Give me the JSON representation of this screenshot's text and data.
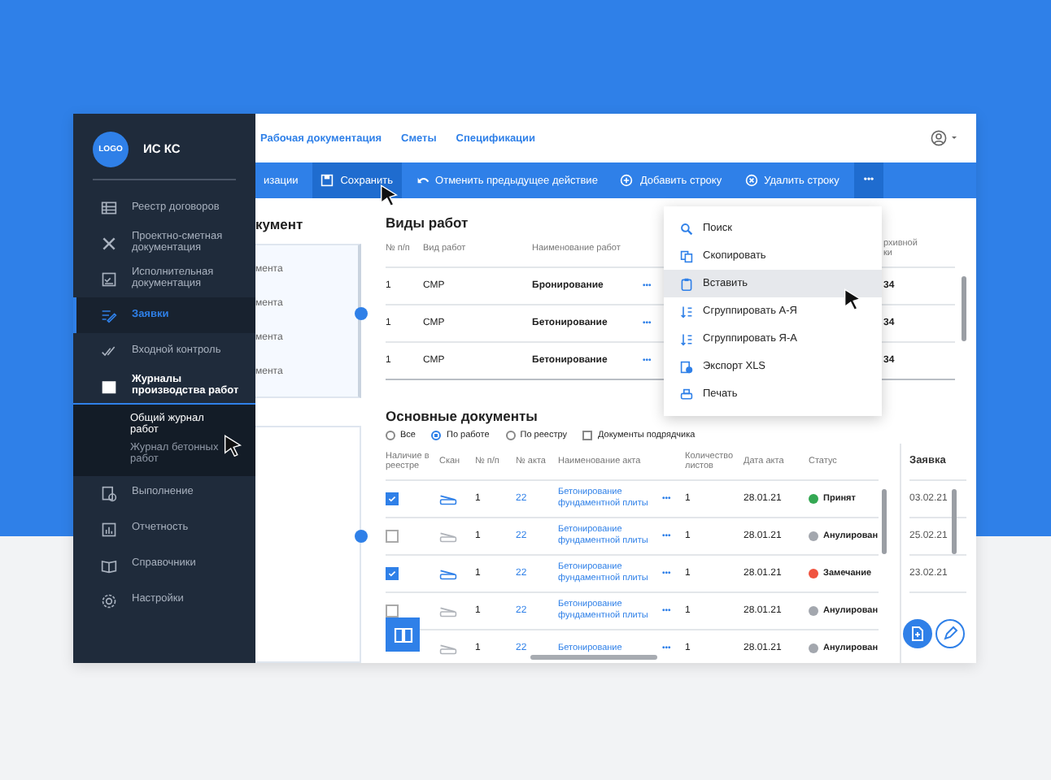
{
  "sidebar": {
    "logo": "LOGO",
    "title": "ИС КС",
    "items": [
      {
        "label": "Реестр договоров",
        "selected": false,
        "expanded": false
      },
      {
        "label": "Проектно-сметная документация",
        "selected": false,
        "expanded": false
      },
      {
        "label": "Исполнительная документация",
        "selected": false,
        "expanded": false
      },
      {
        "label": "Заявки",
        "selected": true,
        "expanded": false
      },
      {
        "label": "Входной контроль",
        "selected": false,
        "expanded": false
      },
      {
        "label": "Журналы производства работ",
        "selected": false,
        "expanded": true,
        "children": [
          {
            "label": "Общий журнал работ",
            "selected": true
          },
          {
            "label": "Журнал бетонных работ",
            "selected": false
          }
        ]
      },
      {
        "label": "Выполнение",
        "selected": false,
        "expanded": false
      },
      {
        "label": "Отчетность",
        "selected": false,
        "expanded": false
      },
      {
        "label": "Справочники",
        "selected": false,
        "expanded": false
      },
      {
        "label": "Настройки",
        "selected": false,
        "expanded": false
      }
    ]
  },
  "top_nav": {
    "tabs": [
      "Рабочая документация",
      "Сметы",
      "Спецификации"
    ]
  },
  "toolbar": {
    "items": [
      {
        "label": "изации",
        "active": false
      },
      {
        "label": "Сохранить",
        "active": true
      },
      {
        "label": "Отменить предыдущее действие",
        "active": false
      },
      {
        "label": "Добавить строку",
        "active": false
      },
      {
        "label": "Удалить строку",
        "active": false
      }
    ],
    "more": {
      "label": "•••",
      "active": true
    }
  },
  "left_panel": {
    "title": "кумент",
    "items": [
      "мента",
      "мента",
      "мента",
      "мента"
    ]
  },
  "work_types": {
    "title": "Виды работ",
    "columns": [
      "№ п/п",
      "Вид работ",
      "Наименование работ",
      "рхивной\nки"
    ],
    "rows": [
      {
        "number": "1",
        "type": "СМР",
        "name": "Бронирование",
        "more": "•••",
        "column_4": "34"
      },
      {
        "number": "1",
        "type": "СМР",
        "name": "Бетонирование",
        "more": "•••",
        "column_4": "34"
      },
      {
        "number": "1",
        "type": "СМР",
        "name": "Бетонирование",
        "more": "•••",
        "column_4": "34"
      }
    ]
  },
  "context_menu": {
    "items": [
      {
        "label": "Поиск",
        "selected": false
      },
      {
        "label": "Скопировать",
        "selected": false
      },
      {
        "label": "Вставить",
        "selected": true
      },
      {
        "label": "Сгруппировать А-Я",
        "selected": false
      },
      {
        "label": "Сгруппировать Я-А",
        "selected": false
      },
      {
        "label": "Экспорт XLS",
        "selected": false
      },
      {
        "label": "Печать",
        "selected": false
      }
    ]
  },
  "documents": {
    "title": "Основные документы",
    "filters": [
      {
        "label": "Все",
        "selected": false
      },
      {
        "label": "По работе",
        "selected": true
      },
      {
        "label": "По реестру",
        "selected": false
      }
    ],
    "contractor_docs": {
      "label": "Документы подрядчика",
      "checked": false
    },
    "columns": [
      "Наличие в реестре",
      "Скан",
      "№ п/п",
      "№ акта",
      "Наименование акта",
      "Количество листов",
      "Дата акта",
      "Статус"
    ],
    "rows": [
      {
        "in_registry": true,
        "scanned": true,
        "number": "1",
        "act": "22",
        "name": "Бетонирование фундаментной плиты",
        "more": "•••",
        "sheets": "1",
        "date": "28.01.21",
        "status": {
          "label": "Принят",
          "color": "#34a853"
        }
      },
      {
        "in_registry": false,
        "scanned": false,
        "number": "1",
        "act": "22",
        "name": "Бетонирование фундаментной плиты",
        "more": "•••",
        "sheets": "1",
        "date": "28.01.21",
        "status": {
          "label": "Анулирован",
          "color": "#a3a7ae"
        }
      },
      {
        "in_registry": true,
        "scanned": true,
        "number": "1",
        "act": "22",
        "name": "Бетонирование фундаментной плиты",
        "more": "•••",
        "sheets": "1",
        "date": "28.01.21",
        "status": {
          "label": "Замечание",
          "color": "#f0533f"
        }
      },
      {
        "in_registry": false,
        "scanned": false,
        "number": "1",
        "act": "22",
        "name": "Бетонирование фундаментной плиты",
        "more": "•••",
        "sheets": "1",
        "date": "28.01.21",
        "status": {
          "label": "Анулирован",
          "color": "#a3a7ae"
        }
      },
      {
        "scanned": false,
        "number": "1",
        "act": "22",
        "name": "Бетонирование",
        "more": "•••",
        "sheets": "1",
        "date": "28.01.21",
        "status": {
          "label": "Анулирован",
          "color": "#a3a7ae"
        }
      }
    ],
    "request_column": {
      "title": "Заявка",
      "values": [
        "03.02.21",
        "25.02.21",
        "23.02.21"
      ]
    }
  }
}
